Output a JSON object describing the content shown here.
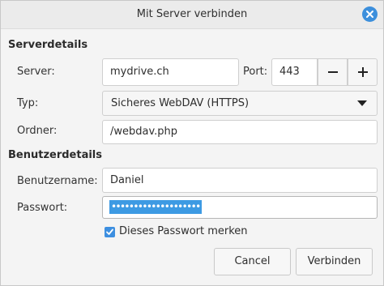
{
  "window": {
    "title": "Mit Server verbinden",
    "close_icon": "close-icon",
    "accent_color": "#3c8fdc"
  },
  "server_section": {
    "header": "Serverdetails",
    "server_label": "Server:",
    "server_value": "mydrive.ch",
    "port_label": "Port:",
    "port_value": "443",
    "decrement_icon": "minus-icon",
    "increment_icon": "plus-icon",
    "type_label": "Typ:",
    "type_value": "Sicheres WebDAV (HTTPS)",
    "type_icon": "dropdown-arrow-icon",
    "folder_label": "Ordner:",
    "folder_value": "/webdav.php"
  },
  "user_section": {
    "header": "Benutzerdetails",
    "username_label": "Benutzername:",
    "username_value": "Daniel",
    "password_label": "Passwort:",
    "password_value": "••••••••••••••••••••",
    "remember_label": "Dieses Passwort merken",
    "remember_checked": true
  },
  "buttons": {
    "cancel_label": "Cancel",
    "connect_label": "Verbinden"
  }
}
